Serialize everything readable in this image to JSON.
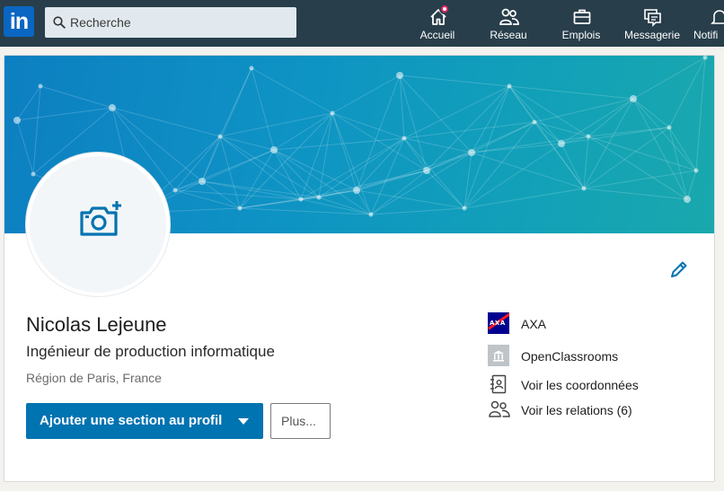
{
  "nav": {
    "logo_text": "in",
    "search_placeholder": "Recherche",
    "items": [
      {
        "label": "Accueil",
        "icon": "home-icon",
        "badge": true
      },
      {
        "label": "Réseau",
        "icon": "network-icon"
      },
      {
        "label": "Emplois",
        "icon": "briefcase-icon"
      },
      {
        "label": "Messagerie",
        "icon": "messaging-icon"
      },
      {
        "label": "Notifi",
        "icon": "notifications-icon"
      }
    ]
  },
  "profile": {
    "name": "Nicolas Lejeune",
    "headline": "Ingénieur de production informatique",
    "location": "Région de Paris, France",
    "add_section_label": "Ajouter une section au profil",
    "more_label": "Plus...",
    "company": "AXA",
    "school": "OpenClassrooms",
    "contact_info_label": "Voir les coordonnées",
    "connections_label": "Voir les relations (6)"
  },
  "colors": {
    "nav_bg": "#283e4a",
    "brand_blue": "#0073b1",
    "badge_red": "#e0245e",
    "banner_start": "#0d7fc2",
    "banner_end": "#1aa8ad"
  }
}
